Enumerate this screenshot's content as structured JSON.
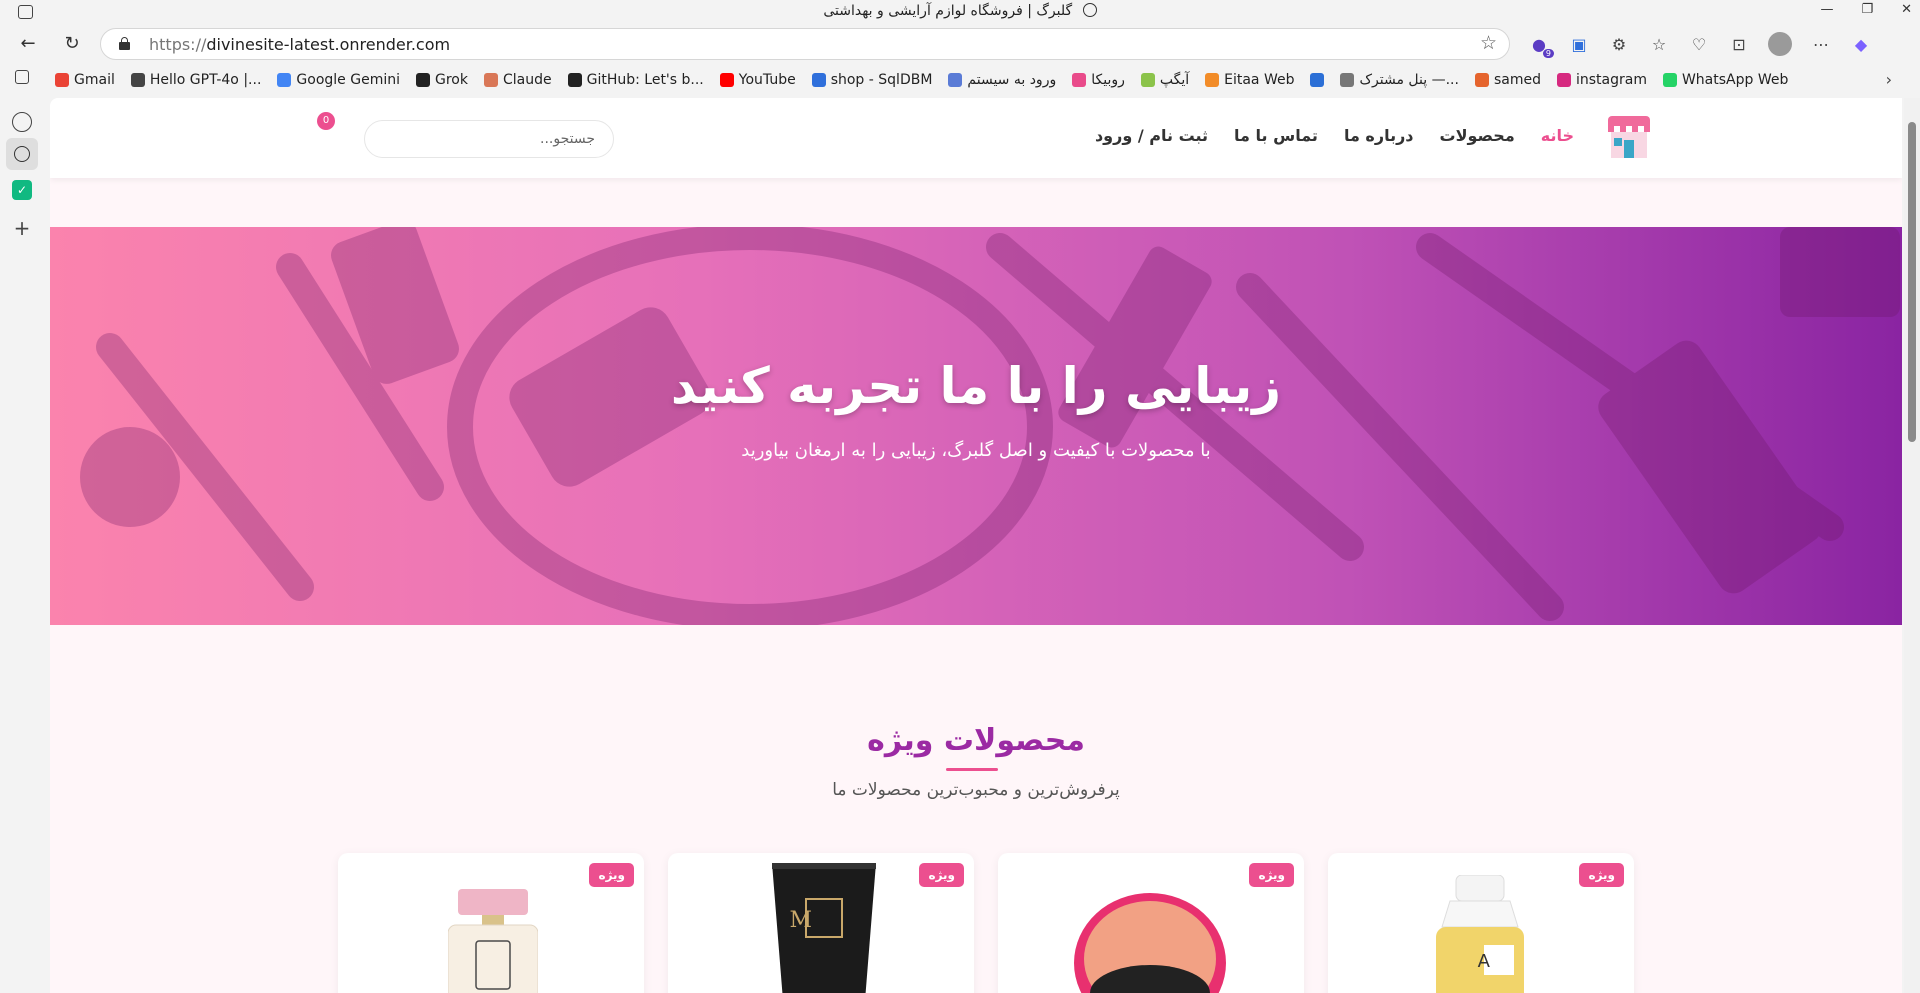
{
  "browser": {
    "window_title": "گلبرگ | فروشگاه لوازم آرایشی و بهداشتی",
    "url_protocol": "https://",
    "url_host": "divinesite-latest.onrender.com",
    "extension_badge": "9"
  },
  "bookmarks": [
    {
      "label": "Gmail",
      "icon": "gmail-icon",
      "color": "#ea4335"
    },
    {
      "label": "Hello GPT-4o |...",
      "icon": "openai-icon",
      "color": "#444444"
    },
    {
      "label": "Google Gemini",
      "icon": "gemini-icon",
      "color": "#4285f4"
    },
    {
      "label": "Grok",
      "icon": "grok-icon",
      "color": "#222222"
    },
    {
      "label": "Claude",
      "icon": "claude-icon",
      "color": "#d97757"
    },
    {
      "label": "GitHub: Let's b...",
      "icon": "github-icon",
      "color": "#222222"
    },
    {
      "label": "YouTube",
      "icon": "youtube-icon",
      "color": "#ff0000"
    },
    {
      "label": "shop - SqlDBM",
      "icon": "sqldbm-icon",
      "color": "#2f6fdb"
    },
    {
      "label": "ورود به سیستم",
      "icon": "login-icon",
      "color": "#5a7bd6"
    },
    {
      "label": "روبیکا",
      "icon": "rubika-icon",
      "color": "#e94b8a"
    },
    {
      "label": "آیگپ",
      "icon": "igap-icon",
      "color": "#8bc34a"
    },
    {
      "label": "Eitaa Web",
      "icon": "eitaa-icon",
      "color": "#f28c28"
    },
    {
      "label": "",
      "icon": "edge-icon",
      "color": "#2b6fd6"
    },
    {
      "label": "پنل مشترک —...",
      "icon": "panel-icon",
      "color": "#777777"
    },
    {
      "label": "samed",
      "icon": "samed-icon",
      "color": "#e5642d"
    },
    {
      "label": "instagram",
      "icon": "instagram-icon",
      "color": "#d6297f"
    },
    {
      "label": "WhatsApp Web",
      "icon": "whatsapp-icon",
      "color": "#25d366"
    }
  ],
  "site": {
    "nav": {
      "home": "خانه",
      "products": "محصولات",
      "about": "درباره ما",
      "contact": "تماس با ما",
      "auth": "ثبت نام / ورود"
    },
    "search_placeholder": "جستجو...",
    "cart_count": "0",
    "hero": {
      "title": "زیبایی را با ما تجربه کنید",
      "subtitle": "با محصولات با کیفیت و اصل گلبرگ، زیبایی را به ارمغان بیاورید"
    },
    "featured": {
      "title": "محصولات ویژه",
      "subtitle": "پرفروش‌ترین و محبوب‌ترین محصولات ما",
      "badge": "ویژه",
      "products": [
        {
          "kind": "yellow-cleanser-bottle"
        },
        {
          "kind": "pink-compact-blush"
        },
        {
          "kind": "black-cream-tube"
        },
        {
          "kind": "pink-perfume-bottle"
        }
      ]
    }
  },
  "colors": {
    "accent_pink": "#ec4f8f",
    "heading_purple": "#9b2aa3",
    "hero_start": "#fb83ad",
    "hero_end": "#8a24a2"
  }
}
